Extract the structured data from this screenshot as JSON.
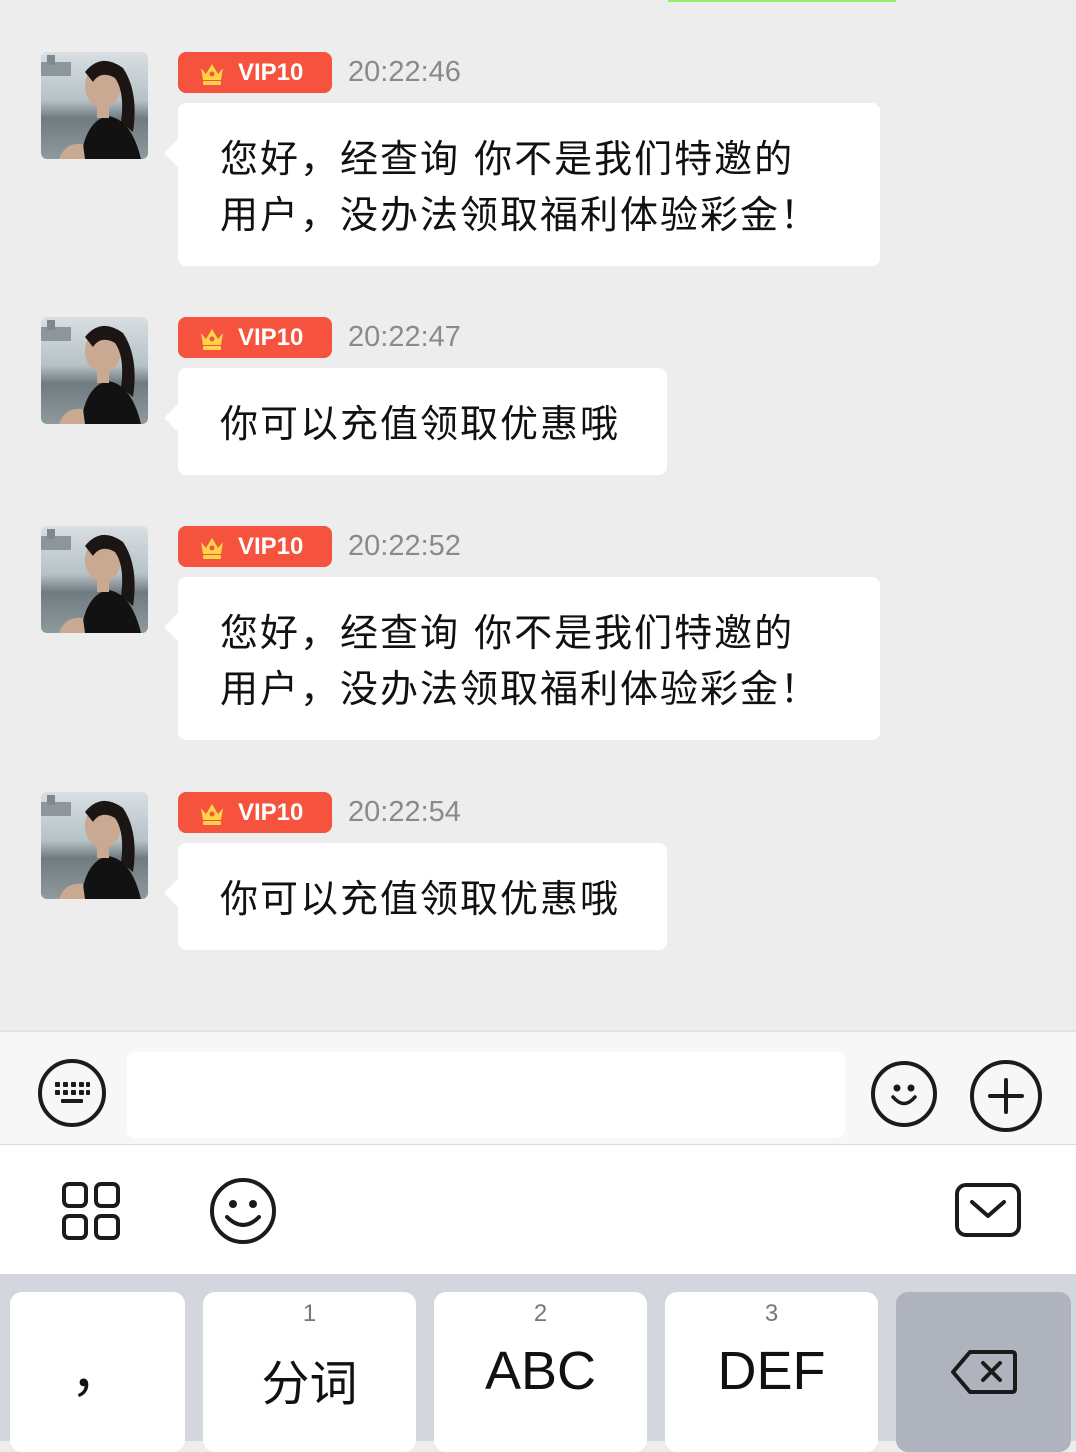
{
  "messages": [
    {
      "badge": "VIP10",
      "time": "20:22:46",
      "lines": [
        "您好，经查询 你不是我们特邀的",
        "用户，没办法领取福利体验彩金！"
      ]
    },
    {
      "badge": "VIP10",
      "time": "20:22:47",
      "lines": [
        "你可以充值领取优惠哦"
      ]
    },
    {
      "badge": "VIP10",
      "time": "20:22:52",
      "lines": [
        "您好，经查询 你不是我们特邀的",
        "用户，没办法领取福利体验彩金！"
      ]
    },
    {
      "badge": "VIP10",
      "time": "20:22:54",
      "lines": [
        "你可以充值领取优惠哦"
      ]
    }
  ],
  "input": {
    "value": "",
    "left_icon": "keyboard-icon",
    "emoji_icon": "emoji-icon",
    "plus_icon": "plus-icon"
  },
  "toolbar": {
    "icons": [
      "apps-grid-icon",
      "emoji-icon",
      "keyboard-collapse-icon"
    ]
  },
  "keyboard": {
    "keys": [
      {
        "num": "",
        "label": "，"
      },
      {
        "num": "1",
        "label": "分词"
      },
      {
        "num": "2",
        "label": "ABC"
      },
      {
        "num": "3",
        "label": "DEF"
      }
    ],
    "delete_icon": "backspace-icon"
  },
  "colors": {
    "badge": "#f5533d",
    "bubble": "#ffffff",
    "background": "#ededed"
  }
}
